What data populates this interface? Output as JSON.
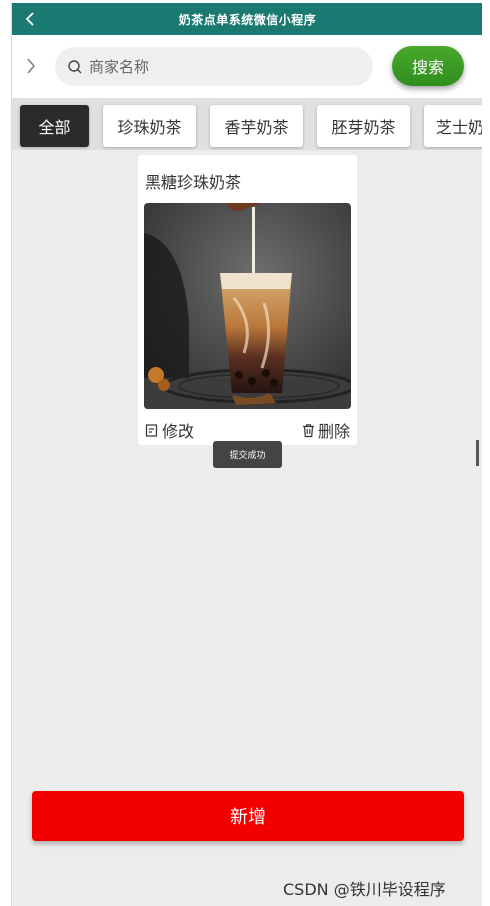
{
  "header": {
    "title": "奶茶点单系统微信小程序"
  },
  "search": {
    "placeholder": "商家名称",
    "button_label": "搜索"
  },
  "categories": [
    "全部",
    "珍珠奶茶",
    "香芋奶茶",
    "胚芽奶茶",
    "芝士奶"
  ],
  "active_category_index": 0,
  "product": {
    "name": "黑糖珍珠奶茶",
    "image": "brown-sugar-pearl-milk-tea-photo",
    "edit_label": "修改",
    "delete_label": "删除"
  },
  "toast": {
    "message": "提交成功"
  },
  "footer": {
    "add_label": "新增"
  },
  "watermark": "CSDN @铁川毕设程序",
  "colors": {
    "titlebar": "#1a7a72",
    "search_button": "#3a9a25",
    "add_button": "#f20000",
    "active_tab": "#2b2b2b"
  }
}
